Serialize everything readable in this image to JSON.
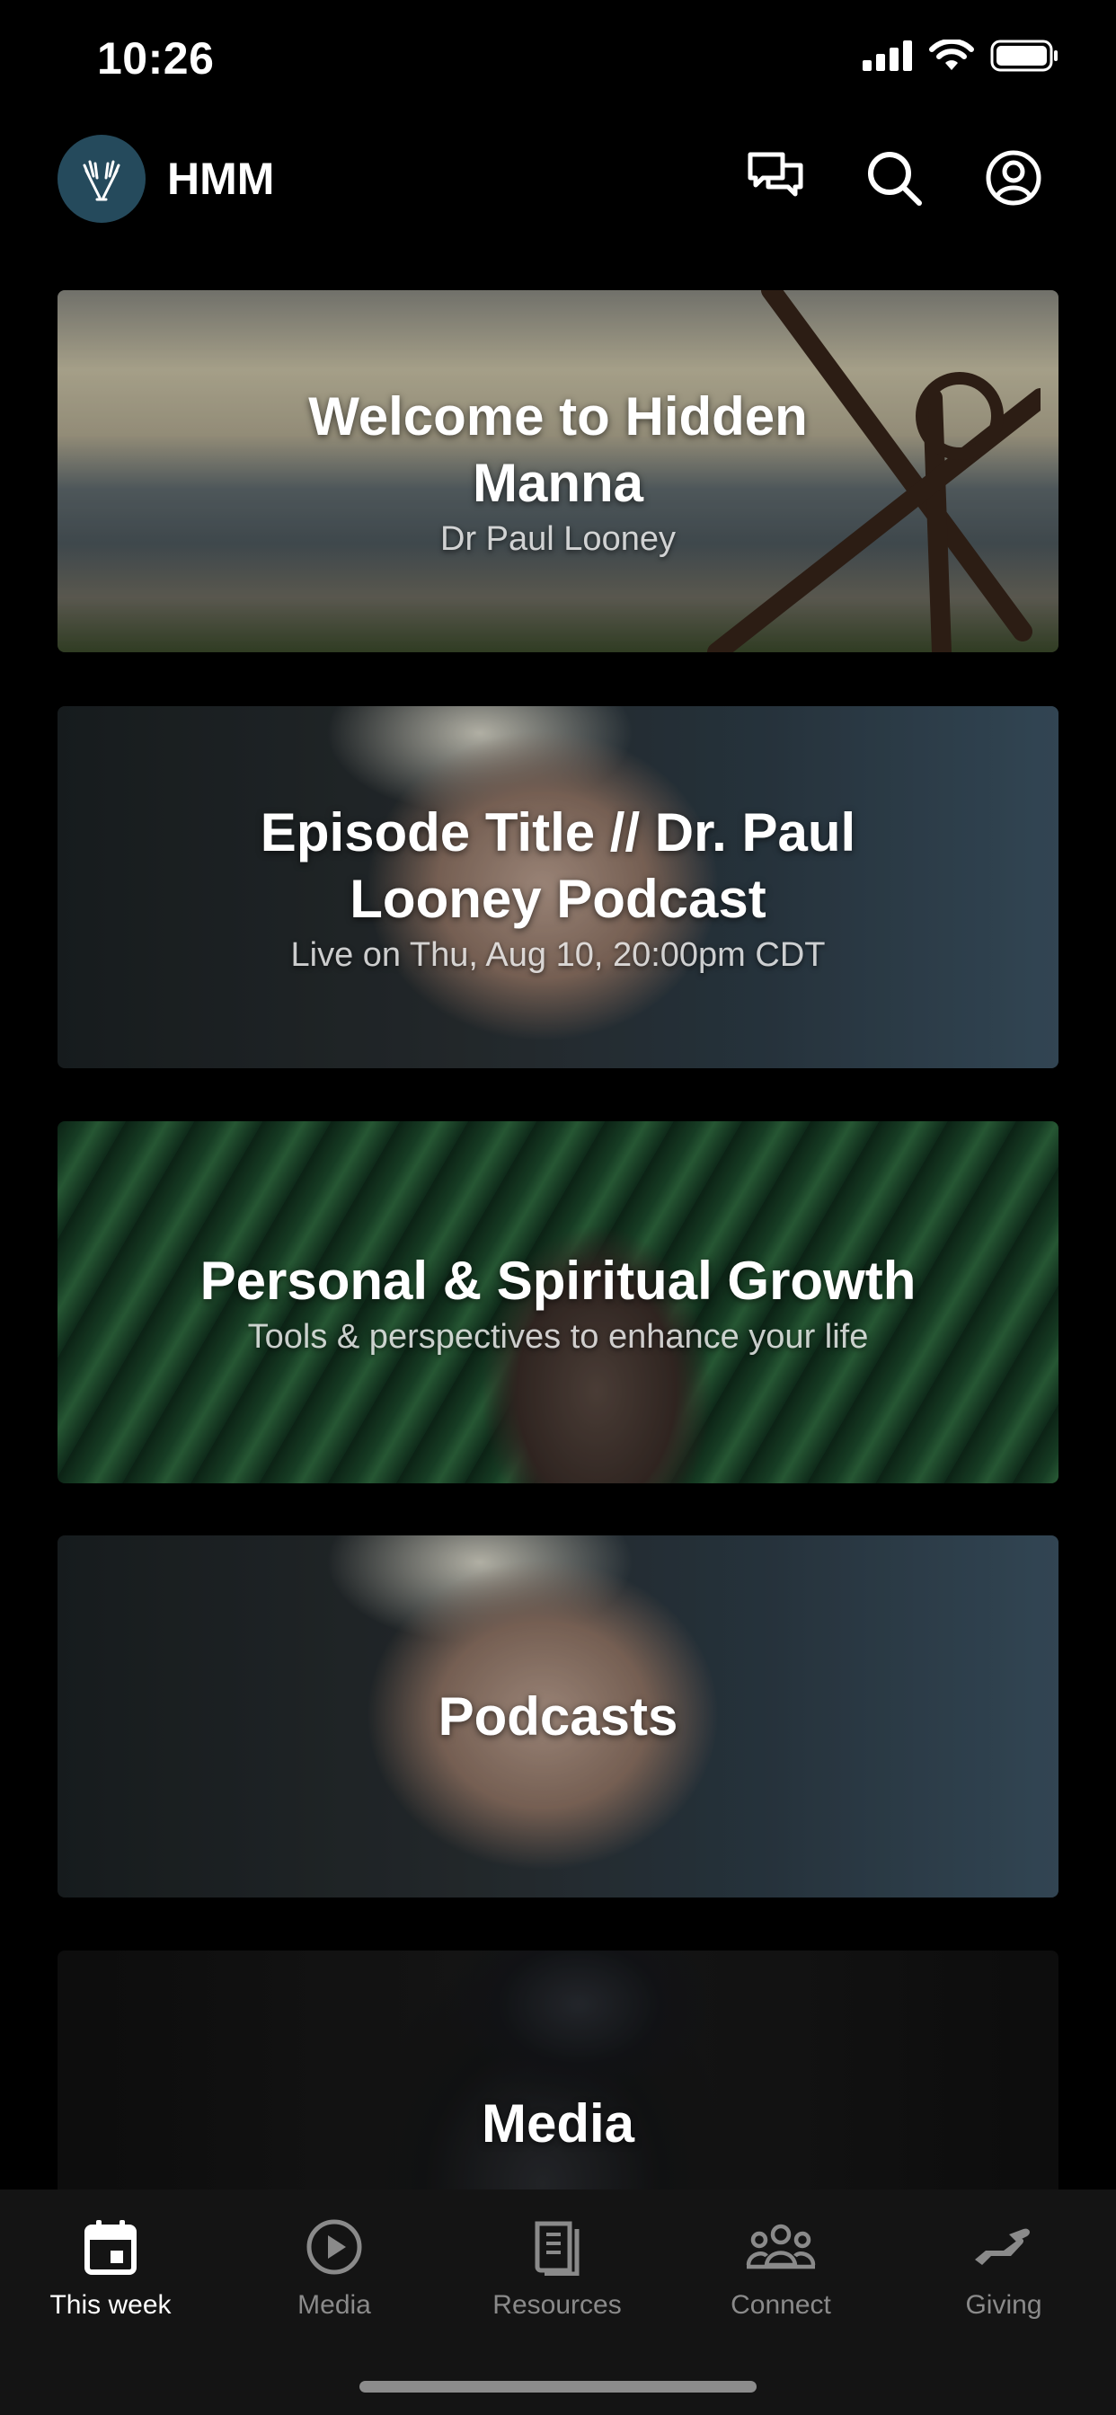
{
  "status_bar": {
    "time": "10:26"
  },
  "header": {
    "app_title": "HMM",
    "icons": [
      "chat-icon",
      "search-icon",
      "profile-icon"
    ]
  },
  "cards": [
    {
      "title": "Welcome to Hidden Manna",
      "subtitle": "Dr Paul Looney"
    },
    {
      "title": "Episode Title // Dr. Paul Looney Podcast",
      "subtitle": "Live on Thu, Aug 10, 20:00pm CDT"
    },
    {
      "title": "Personal & Spiritual Growth",
      "subtitle": "Tools & perspectives to enhance your life"
    },
    {
      "title": "Podcasts",
      "subtitle": ""
    },
    {
      "title": "Media",
      "subtitle": ""
    }
  ],
  "tabbar": {
    "tabs": [
      {
        "label": "This week",
        "icon": "calendar-icon",
        "active": true
      },
      {
        "label": "Media",
        "icon": "play-icon",
        "active": false
      },
      {
        "label": "Resources",
        "icon": "book-icon",
        "active": false
      },
      {
        "label": "Connect",
        "icon": "group-icon",
        "active": false
      },
      {
        "label": "Giving",
        "icon": "giving-icon",
        "active": false
      }
    ]
  },
  "colors": {
    "background": "#000000",
    "tabbar": "#141414",
    "logo_bg": "#254a5c",
    "inactive_tab": "#8a8a8a"
  }
}
